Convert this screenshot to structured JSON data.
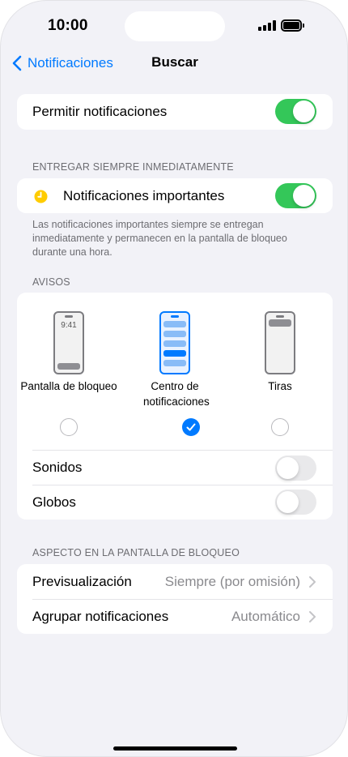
{
  "status_bar": {
    "time": "10:00"
  },
  "nav": {
    "back_label": "Notificaciones",
    "title": "Buscar"
  },
  "allow": {
    "label": "Permitir notificaciones",
    "toggle_on": true
  },
  "deliver": {
    "header": "ENTREGAR SIEMPRE INMEDIATAMENTE",
    "label": "Notificaciones importantes",
    "toggle_on": true,
    "icon": "clock-icon",
    "icon_color": "#ffcc00",
    "footnote": "Las notificaciones importantes siempre se entregan inmediatamente y permanecen en la pantalla de bloqueo durante una hora."
  },
  "alerts": {
    "header": "AVISOS",
    "styles": [
      {
        "caption": "Pantalla de bloqueo",
        "screen_time": "9:41",
        "selected": false
      },
      {
        "caption": "Centro de notificaciones",
        "selected": true
      },
      {
        "caption": "Tiras",
        "selected": false
      }
    ],
    "sounds": {
      "label": "Sonidos",
      "toggle_on": false
    },
    "badges": {
      "label": "Globos",
      "toggle_on": false
    }
  },
  "lock_screen": {
    "header": "ASPECTO EN LA PANTALLA DE BLOQUEO",
    "rows": [
      {
        "label": "Previsualización",
        "value": "Siempre (por omisión)"
      },
      {
        "label": "Agrupar notificaciones",
        "value": "Automático"
      }
    ]
  },
  "colors": {
    "accent": "#007aff",
    "toggle_on": "#34c759",
    "background": "#f2f2f7"
  }
}
